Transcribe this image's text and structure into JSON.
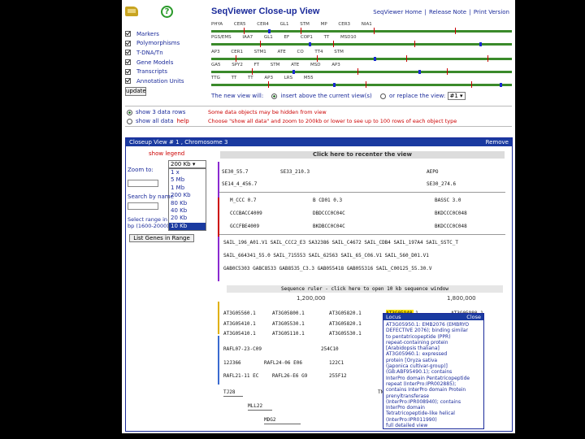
{
  "header": {
    "title": "SeqViewer Close-up View",
    "links": [
      "SeqViewer Home",
      "Release Note",
      "Print Version"
    ],
    "help_icon": "question-circle-icon",
    "logo_icon": "tair-logo-icon"
  },
  "tracks": {
    "items": [
      "Markers",
      "Polymorphisms",
      "T-DNA/Tn",
      "Gene Models",
      "Transcripts",
      "Annotation Units"
    ],
    "update_label": "update"
  },
  "overview": {
    "rows": [
      "PHYA  CER5  CER4  GL1  STM  MP  CER3  NIA1",
      "PGS/EMS  IAA7  GL1  EF  COP1  TT  MSD10",
      "AP3  CER1  STM1  ATE  CO  TT4  STM",
      "GA5  SPY2  FT  STM  ATE  MSD  AP3",
      "TTG  TT  TT  AP3  LRS  M55"
    ]
  },
  "new_view": {
    "label": "The new view will:",
    "insert_label": "insert above the current view(s)",
    "replace_label": "or replace the view:",
    "replace_value": "#1"
  },
  "rows_panel": {
    "show3": "show 3 data rows",
    "showall": "show all data",
    "help": "help",
    "warning1": "Some data objects may be hidden from view",
    "warning2": "Choose \"show all data\" and zoom to 200kb or lower to see up to 100 rows of each object type"
  },
  "closeup": {
    "title": "Closeup View # 1 , Chromosome 3",
    "remove_label": "Remove",
    "show_legend": "show legend",
    "zoom_label": "Zoom to:",
    "zoom_selected": "200 Kb",
    "zoom_options": [
      "1 x",
      "5 Mb",
      "1 Mb",
      "200 Kb",
      "80 Kb",
      "40 Kb",
      "20 Kb",
      "10 Kb"
    ],
    "zoom_highlighted": "10 Kb",
    "search_label": "Search by name",
    "range_label": "Select range in bp (1600-2000)",
    "list_button": "List Genes in Range",
    "recenter": "Click here to recenter the view",
    "ruler": "Sequence ruler - click here to open 10 kb sequence window",
    "scale1": "1,200,000",
    "scale2": "1,800,000"
  },
  "map_rows": {
    "markers1": [
      "SE30_55.7",
      "SE33_210.3",
      "AEPO"
    ],
    "markers2": [
      "SE14_4_456.7",
      "SE30_274.6"
    ],
    "poly1": [
      "M_CCC 0.7",
      "B CD01 0.3",
      "BASSC 3.0"
    ],
    "poly2": [
      "CCCBACC4009",
      "DBDCCC0C04C",
      "BKDCCC0C048"
    ],
    "poly3": [
      "GCCFBE4009",
      "BKDBCC0C04C",
      "BKDCCC0C048"
    ],
    "tdna1": "SAIL_196_A01.V1  SAIL_CCC2_E3  SA32386  SAIL_C4672  SAIL_CDB4  SAIL_197A4  SAIL_SSTC_T",
    "tdna2": "SAIL_664341_55.0  SAIL_715553  SAIL_62563  SAIL_65_C06.V1  SAIL_560_D01.V1",
    "tdna3": "GAB0C5303  GABC8533  GAB8535_C3.3  GAB055418  GAB055316  SAIL_C00125_55.30.V",
    "genes1": [
      "AT3G05560.1",
      "AT3G05800.1",
      "AT3G05820.1",
      "AT3G05940.1",
      "AT3G05980.1"
    ],
    "genes2": [
      "AT3G05410.1",
      "AT3G05530.1",
      "AT3G05820.1",
      "AT3G05920.1",
      "AT3G06200.1"
    ],
    "genes3": [
      "AT3G05410.1",
      "AT3G05110.1",
      "AT3G05530.1"
    ],
    "trans1": [
      "RAFL07-23-C09",
      "RAFL16-15-D11",
      "254C10",
      "114",
      "11CC"
    ],
    "trans2": [
      "12J366",
      "RAFL24-06 E06",
      "122C1",
      "115",
      "112"
    ],
    "trans3": [
      "RAFL21-11 EC",
      "RAFL26-E6 G9",
      "255F12",
      "114",
      "112"
    ],
    "units": [
      "TJ28",
      "MLL22",
      "MDG2",
      "TNEM"
    ]
  },
  "popup": {
    "title": "Locus",
    "close": "Close",
    "body": [
      "AT3G05950.1: EMB2076 (EMBRYO",
      "DEFECTIVE 2076); binding similar",
      "to pentatricopeptide (PPR)",
      "repeat-containing protein",
      "[Arabidopsis thaliana]",
      "AT3G05960.1: expressed",
      "protein [Oryza sativa",
      "(japonica cultivar-group)]",
      "(GB:ABF95490.1); contains",
      "InterPro domain Pentatricopeptide",
      "repeat (InterPro:IPR002885);",
      "contains InterPro domain Protein",
      "prenyltransferase",
      "(InterPro:IPR008940); contains",
      "InterPro domain",
      "Tetratricopeptide-like helical",
      "(InterPro:IPR011990)",
      "full detailed view"
    ]
  }
}
